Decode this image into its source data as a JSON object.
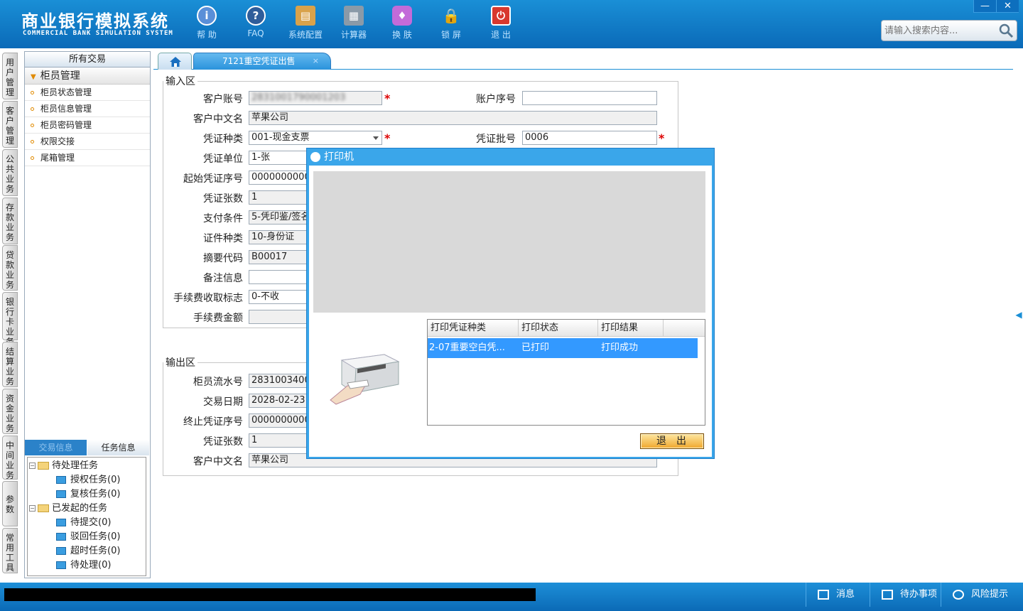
{
  "app": {
    "title_cn": "商业银行模拟系统",
    "title_en": "COMMERCIAL BANK SIMULATION SYSTEM",
    "accent": "#1a8fd6"
  },
  "toolbar": [
    {
      "label": "帮 助",
      "icon": "info-icon",
      "glyph": "i",
      "color": "#5a8fd8"
    },
    {
      "label": "FAQ",
      "icon": "question-icon",
      "glyph": "?",
      "color": "#2f5d9a"
    },
    {
      "label": "系统配置",
      "icon": "toolbox-icon",
      "glyph": "▤",
      "color": "#d9a24a"
    },
    {
      "label": "计算器",
      "icon": "calculator-icon",
      "glyph": "▦",
      "color": "#8a9aa8"
    },
    {
      "label": "换 肤",
      "icon": "shirt-icon",
      "glyph": "♦",
      "color": "#c36bd9"
    },
    {
      "label": "锁 屏",
      "icon": "lock-icon",
      "glyph": "🔒",
      "color": "#e8b93a"
    },
    {
      "label": "退 出",
      "icon": "power-icon",
      "glyph": "⏻",
      "color": "#d8382e"
    }
  ],
  "window_controls": {
    "minimize": "—",
    "close": "✕"
  },
  "search": {
    "placeholder": "请输入搜索内容..."
  },
  "vertical_tabs": [
    "用户管理",
    "客户管理",
    "公共业务",
    "存款业务",
    "贷款业务",
    "银行卡业务",
    "结算业务",
    "资金业务",
    "中间业务",
    "参数",
    "常用工具"
  ],
  "left_panel": {
    "header": "所有交易",
    "group": "柜员管理",
    "items": [
      "柜员状态管理",
      "柜员信息管理",
      "柜员密码管理",
      "权限交接",
      "尾箱管理"
    ],
    "bottom_tabs": [
      "交易信息",
      "任务信息"
    ],
    "tree": {
      "pending": "待处理任务",
      "pending_children": [
        "授权任务(0)",
        "复核任务(0)"
      ],
      "initiated": "已发起的任务",
      "initiated_children": [
        "待提交(0)",
        "驳回任务(0)",
        "超时任务(0)",
        "待处理(0)"
      ]
    }
  },
  "tabs": {
    "home_icon": "home-icon",
    "active": "7121重空凭证出售",
    "close": "×"
  },
  "input_area": {
    "legend": "输入区",
    "account_label": "客户账号",
    "account_value": "2831001790001203",
    "account_seq_label": "账户序号",
    "account_seq_value": "",
    "name_label": "客户中文名",
    "name_value": "苹果公司",
    "voucher_type_label": "凭证种类",
    "voucher_type_value": "001-现金支票",
    "batch_label": "凭证批号",
    "batch_value": "0006",
    "unit_label": "凭证单位",
    "unit_value": "1-张",
    "start_seq_label": "起始凭证序号",
    "start_seq_value": "000000000000",
    "count_label": "凭证张数",
    "count_value": "1",
    "pay_cond_label": "支付条件",
    "pay_cond_value": "5-凭印鉴/签名",
    "id_type_label": "证件种类",
    "id_type_value": "10-身份证",
    "summary_label": "摘要代码",
    "summary_value": "B00017",
    "remark_label": "备注信息",
    "remark_value": "",
    "fee_flag_label": "手续费收取标志",
    "fee_flag_value": "0-不收",
    "fee_amt_label": "手续费金额",
    "fee_amt_value": ""
  },
  "output_area": {
    "legend": "输出区",
    "serial_label": "柜员流水号",
    "serial_value": "283100340000",
    "date_label": "交易日期",
    "date_value": "2028-02-23",
    "end_seq_label": "终止凭证序号",
    "end_seq_value": "000000000000",
    "count_label": "凭证张数",
    "count_value": "1",
    "name_label": "客户中文名",
    "name_value": "苹果公司"
  },
  "dialog": {
    "title": "打印机",
    "columns": [
      "打印凭证种类",
      "打印状态",
      "打印结果"
    ],
    "rows": [
      {
        "type": "2-07重要空白凭...",
        "status": "已打印",
        "result": "打印成功"
      }
    ],
    "exit_label": "退出"
  },
  "statusbar": {
    "messages": "消息",
    "todo": "待办事项",
    "risk": "风险提示"
  }
}
